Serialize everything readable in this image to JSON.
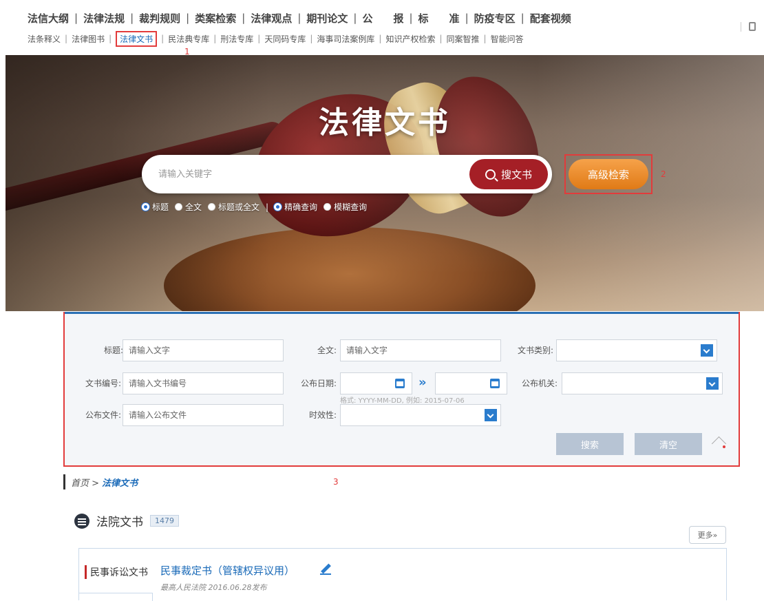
{
  "nav": {
    "primary": [
      "法信大纲",
      "法律法规",
      "裁判规则",
      "类案检索",
      "法律观点",
      "期刊论文",
      "公　　报",
      "标　　准",
      "防疫专区",
      "配套视频"
    ],
    "secondary": [
      "法条释义",
      "法律图书",
      "法律文书",
      "民法典专库",
      "刑法专库",
      "天同码专库",
      "海事司法案例库",
      "知识产权检索",
      "同案智推",
      "智能问答"
    ],
    "active": "法律文书",
    "sep": "|"
  },
  "markers": {
    "m1": "1",
    "m2": "2",
    "m3": "3"
  },
  "hero": {
    "title": "法律文书",
    "search_placeholder": "请输入关键字",
    "search_button": "搜文书",
    "advanced_button": "高级检索",
    "scope_options": [
      {
        "label": "标题",
        "selected": true
      },
      {
        "label": "全文",
        "selected": false
      },
      {
        "label": "标题或全文",
        "selected": false
      }
    ],
    "match_options": [
      {
        "label": "精确查询",
        "selected": true
      },
      {
        "label": "模糊查询",
        "selected": false
      }
    ]
  },
  "form": {
    "title_label": "标题:",
    "title_placeholder": "请输入文字",
    "fulltext_label": "全文:",
    "fulltext_placeholder": "请输入文字",
    "category_label": "文书类别:",
    "docno_label": "文书编号:",
    "docno_placeholder": "请输入文书编号",
    "date_label": "公布日期:",
    "date_hint": "格式: YYYY-MM-DD, 例如: 2015-07-06",
    "authority_label": "公布机关:",
    "pubfile_label": "公布文件:",
    "pubfile_placeholder": "请输入公布文件",
    "validity_label": "时效性:",
    "search_button": "搜索",
    "clear_button": "清空"
  },
  "breadcrumb": {
    "home": "首页 >",
    "current": "法律文书"
  },
  "result": {
    "title": "法院文书",
    "count": "1479",
    "more": "更多»",
    "category": "民事诉讼文书",
    "item_title": "民事裁定书（管辖权异议用）",
    "item_meta": "最高人民法院  2016.06.28发布"
  },
  "colors": {
    "accent": "#a51f26",
    "link": "#1a6ab8",
    "highlight": "#e23b3b",
    "orange": "#e07a16"
  }
}
